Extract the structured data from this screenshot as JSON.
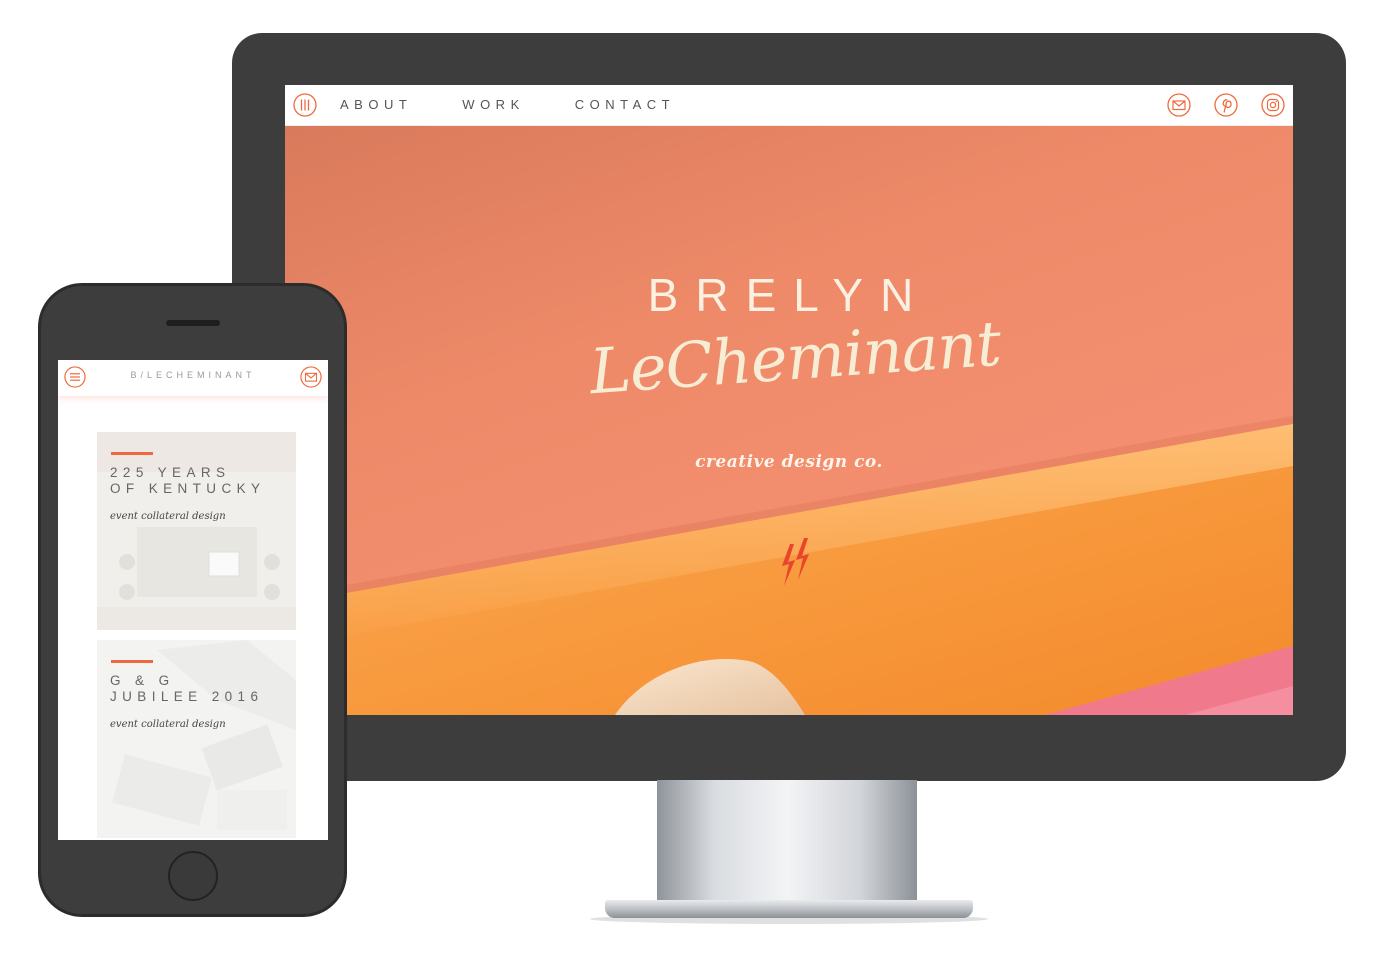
{
  "desktop": {
    "nav": {
      "links": [
        "ABOUT",
        "WORK",
        "CONTACT"
      ],
      "icons": [
        "menu-icon",
        "mail-icon",
        "pinterest-icon",
        "instagram-icon"
      ]
    },
    "hero": {
      "brand_first": "BRELYN",
      "brand_last": "LeCheminant",
      "tagline": "creative design co.",
      "mark_icon": "lightning-bolt-icon"
    }
  },
  "mobile": {
    "nav": {
      "title": "B/LECHEMINANT",
      "icons": [
        "menu-icon",
        "mail-icon"
      ]
    },
    "cards": [
      {
        "title": "225 YEARS\nOF KENTUCKY",
        "subtitle": "event collateral design"
      },
      {
        "title": "G & G\nJUBILEE 2016",
        "subtitle": "event collateral design"
      }
    ]
  },
  "colors": {
    "accent": "#ee6a3e",
    "hero_background": "#ee8762",
    "device_frame": "#3d3d3d",
    "cream_text": "#fbf1e2"
  }
}
